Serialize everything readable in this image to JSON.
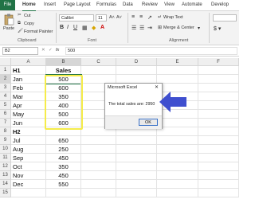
{
  "menu": [
    "File",
    "Home",
    "Insert",
    "Page Layout",
    "Formulas",
    "Data",
    "Review",
    "View",
    "Automate",
    "Develop"
  ],
  "ribbon": {
    "paste": "Paste",
    "cut": "Cut",
    "copy": "Copy",
    "format_painter": "Format Painter",
    "clipboard_group": "Clipboard",
    "font_name": "Calibri",
    "font_size": "11",
    "font_group": "Font",
    "bold": "B",
    "italic": "I",
    "underline": "U",
    "wrap_text": "Wrap Text",
    "merge_center": "Merge & Center",
    "alignment_group": "Alignment"
  },
  "formula_bar": {
    "name_box": "B2",
    "fx": "fx",
    "value": "500"
  },
  "columns": [
    "A",
    "B",
    "C",
    "D",
    "E",
    "F"
  ],
  "rows": [
    {
      "n": "1",
      "a": "H1",
      "b": "Sales",
      "bold": true
    },
    {
      "n": "2",
      "a": "Jan",
      "b": "500"
    },
    {
      "n": "3",
      "a": "Feb",
      "b": "600"
    },
    {
      "n": "4",
      "a": "Mar",
      "b": "350"
    },
    {
      "n": "5",
      "a": "Apr",
      "b": "400"
    },
    {
      "n": "6",
      "a": "May",
      "b": "500"
    },
    {
      "n": "7",
      "a": "Jun",
      "b": "600"
    },
    {
      "n": "8",
      "a": "H2",
      "b": "",
      "bold": true
    },
    {
      "n": "9",
      "a": "Jul",
      "b": "650"
    },
    {
      "n": "10",
      "a": "Aug",
      "b": "250"
    },
    {
      "n": "11",
      "a": "Sep",
      "b": "450"
    },
    {
      "n": "12",
      "a": "Oct",
      "b": "350"
    },
    {
      "n": "13",
      "a": "Nov",
      "b": "450"
    },
    {
      "n": "14",
      "a": "Dec",
      "b": "550"
    },
    {
      "n": "15",
      "a": "",
      "b": ""
    }
  ],
  "dialog": {
    "title": "Microsoft Excel",
    "close": "✕",
    "message": "The total sales are: 2950",
    "ok": "OK"
  },
  "colors": {
    "excel_green": "#217346",
    "highlight": "#f5ec4a",
    "arrow": "#3f4fcf"
  }
}
